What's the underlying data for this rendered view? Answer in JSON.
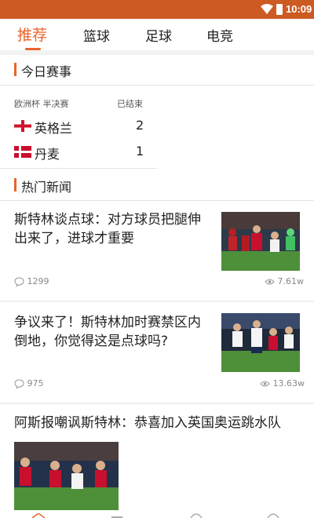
{
  "status_bar": {
    "time": "10:09"
  },
  "tabs": [
    {
      "label": "推荐",
      "active": true
    },
    {
      "label": "篮球",
      "active": false
    },
    {
      "label": "足球",
      "active": false
    },
    {
      "label": "电竞",
      "active": false
    }
  ],
  "today_matches": {
    "section_title": "今日赛事",
    "league": "欧洲杯 半决赛",
    "status": "已结束",
    "home": {
      "name": "英格兰",
      "score": "2",
      "flag": "england-flag"
    },
    "away": {
      "name": "丹麦",
      "score": "1",
      "flag": "denmark-flag"
    }
  },
  "hot_news": {
    "section_title": "热门新闻",
    "items": [
      {
        "title": "斯特林谈点球：对方球员把腿伸出来了，进球才重要",
        "comments": "1299",
        "views": "7.61w"
      },
      {
        "title": "争议来了！斯特林加时赛禁区内倒地，你觉得这是点球吗?",
        "comments": "975",
        "views": "13.63w"
      },
      {
        "title": "阿斯报嘲讽斯特林：恭喜加入英国奥运跳水队"
      }
    ]
  },
  "colors": {
    "accent": "#e8642c",
    "status_bar": "#cc5a22"
  }
}
